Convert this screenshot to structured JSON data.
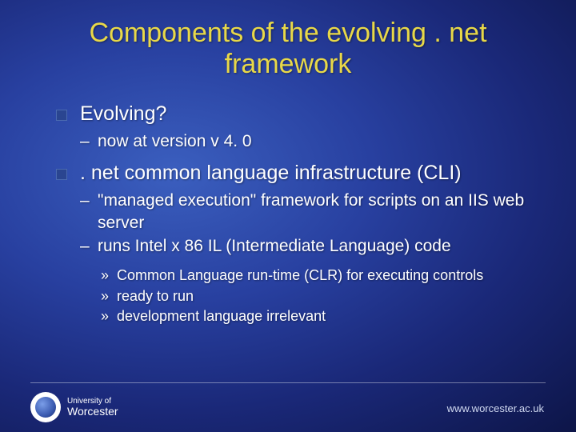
{
  "title": "Components of the evolving . net framework",
  "bullets": [
    {
      "text": "Evolving?",
      "subs": [
        {
          "text": "now at version v 4. 0"
        }
      ]
    },
    {
      "text": ". net common language infrastructure (CLI)",
      "subs": [
        {
          "text": "\"managed execution\" framework for scripts on an IIS web server"
        },
        {
          "text": "runs Intel x 86 IL (Intermediate Language) code",
          "subsubs": [
            {
              "text": "Common Language run-time (CLR) for executing controls"
            },
            {
              "text": "ready to run"
            },
            {
              "text": "development language irrelevant"
            }
          ]
        }
      ]
    }
  ],
  "footer": {
    "logo_line1": "University of",
    "logo_line2": "Worcester",
    "url": "www.worcester.ac.uk"
  }
}
